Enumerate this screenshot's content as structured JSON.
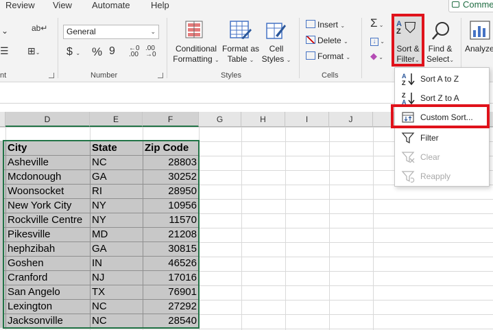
{
  "tabs": [
    "Review",
    "View",
    "Automate",
    "Help"
  ],
  "comments_label": "Comments",
  "ribbon": {
    "number_format": "General",
    "groups": {
      "number": "Number",
      "styles": "Styles",
      "cells": "Cells",
      "alignment_tail": "nt"
    },
    "styles_buttons": {
      "conditional": [
        "Conditional",
        "Formatting"
      ],
      "format_table": [
        "Format as",
        "Table"
      ],
      "cell_styles": [
        "Cell",
        "Styles"
      ]
    },
    "cells_buttons": {
      "insert": "Insert",
      "delete": "Delete",
      "format": "Format"
    },
    "editing": {
      "sort_filter": [
        "Sort &",
        "Filter"
      ],
      "find_select": [
        "Find &",
        "Select"
      ],
      "analyze": "Analyze"
    },
    "number_symbols": {
      "currency": "$",
      "percent": "%",
      "comma": "9"
    }
  },
  "columns": [
    "D",
    "E",
    "F",
    "G",
    "H",
    "I",
    "J"
  ],
  "table": {
    "headers": [
      "City",
      "State",
      "Zip Code"
    ],
    "rows": [
      [
        "Asheville",
        "NC",
        "28803"
      ],
      [
        "Mcdonough",
        "GA",
        "30252"
      ],
      [
        "Woonsocket",
        "RI",
        "28950"
      ],
      [
        "New York City",
        "NY",
        "10956"
      ],
      [
        "Rockville Centre",
        "NY",
        "11570"
      ],
      [
        "Pikesville",
        "MD",
        "21208"
      ],
      [
        "hephzibah",
        "GA",
        "30815"
      ],
      [
        "Goshen",
        "IN",
        "46526"
      ],
      [
        "Cranford",
        "NJ",
        "17016"
      ],
      [
        "San Angelo",
        "TX",
        "76901"
      ],
      [
        "Lexington",
        "NC",
        "27292"
      ],
      [
        "Jacksonville",
        "NC",
        "28540"
      ]
    ]
  },
  "sort_menu": {
    "items": [
      {
        "label": "Sort A to Z",
        "icon": "sort-a-to-z-icon",
        "enabled": true
      },
      {
        "label": "Sort Z to A",
        "icon": "sort-z-to-a-icon",
        "enabled": true
      },
      {
        "label": "Custom Sort...",
        "icon": "custom-sort-icon",
        "enabled": true
      },
      {
        "label": "Filter",
        "icon": "filter-icon",
        "enabled": true
      },
      {
        "label": "Clear",
        "icon": "clear-filter-icon",
        "enabled": false
      },
      {
        "label": "Reapply",
        "icon": "reapply-filter-icon",
        "enabled": false
      }
    ]
  },
  "colors": {
    "highlight": "#e0121b",
    "excel_green": "#217346",
    "selection_fill": "#c8c8c8"
  }
}
